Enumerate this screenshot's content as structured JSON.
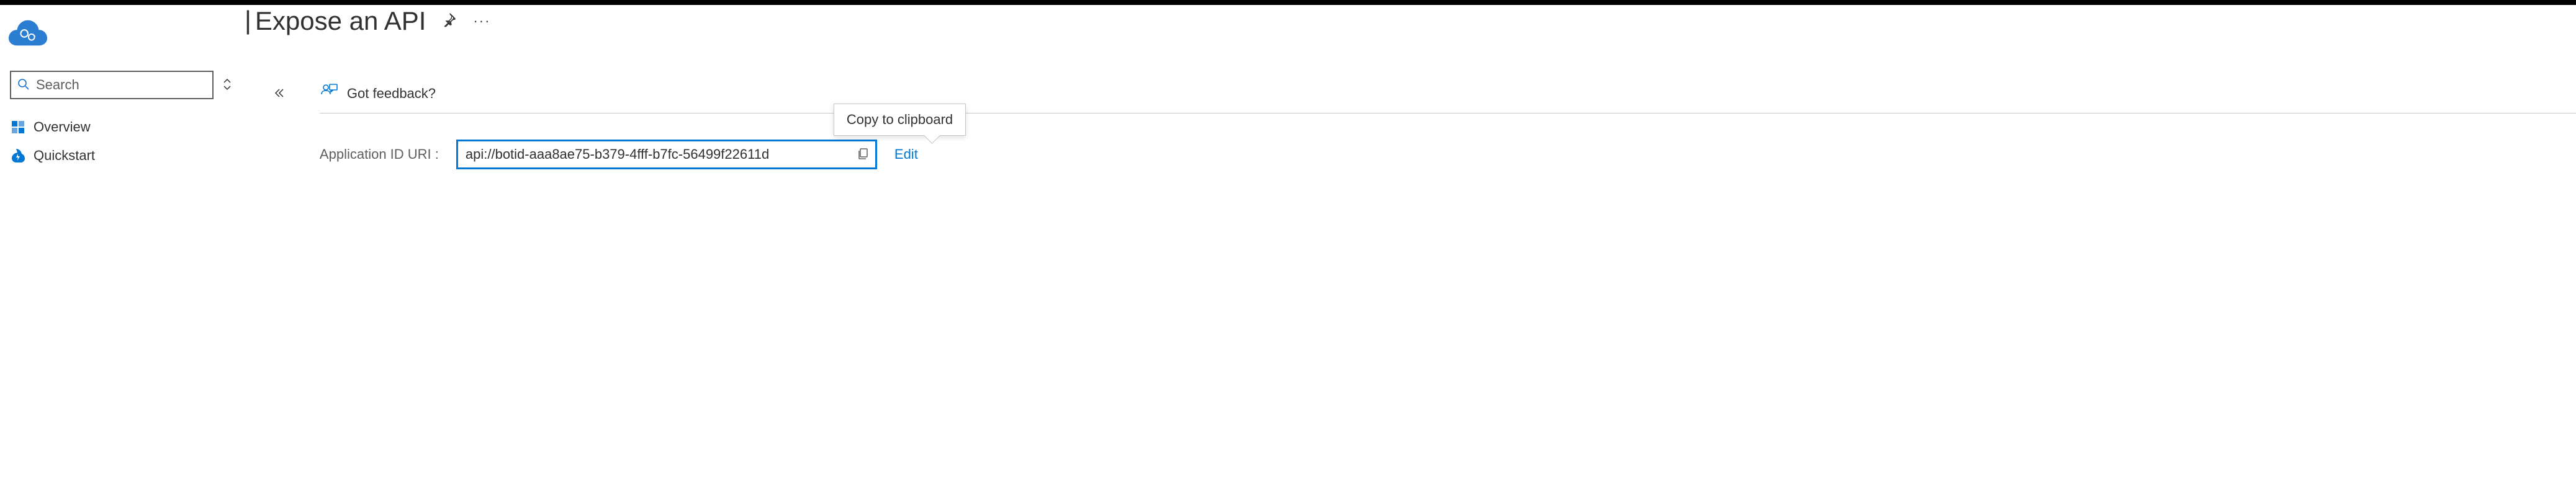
{
  "header": {
    "page_title": "Expose an API"
  },
  "sidebar": {
    "search_placeholder": "Search",
    "items": [
      {
        "label": "Overview",
        "icon": "overview"
      },
      {
        "label": "Quickstart",
        "icon": "quickstart"
      }
    ]
  },
  "toolbar": {
    "feedback_label": "Got feedback?"
  },
  "app_id": {
    "label": "Application ID URI :",
    "value": "api://botid-aaa8ae75-b379-4fff-b7fc-56499f22611d",
    "edit_label": "Edit",
    "tooltip": "Copy to clipboard"
  }
}
